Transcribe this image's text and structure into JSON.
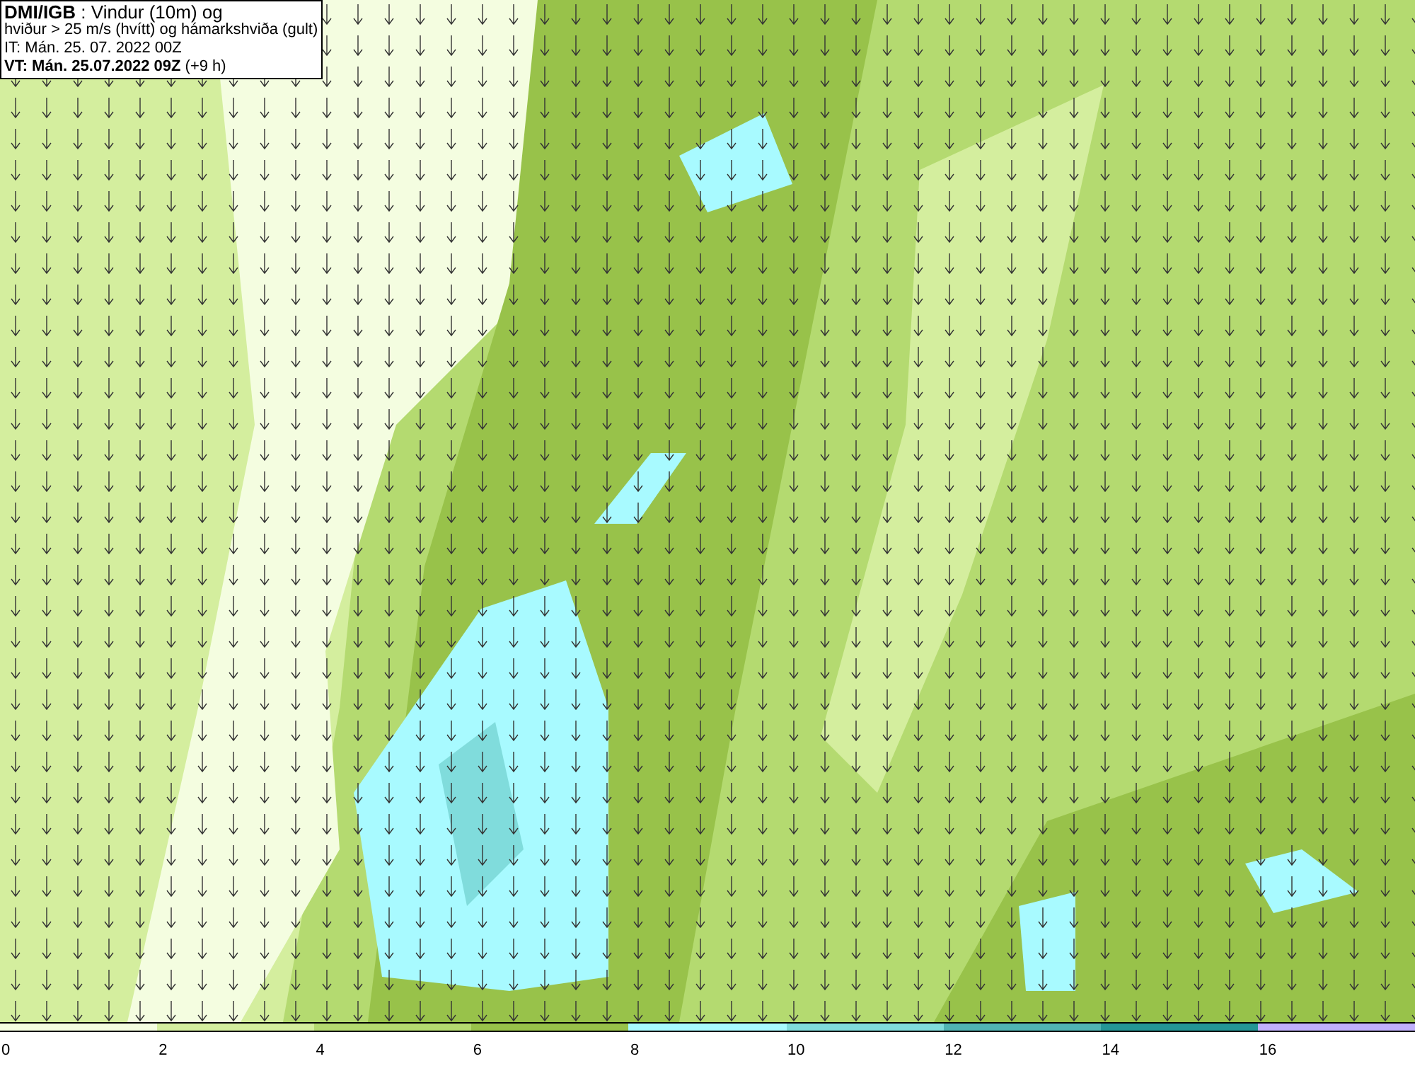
{
  "title": {
    "lines": [
      "**DMI/IGB** : Vindur (10m) og",
      "hviður > 25 m/s (hvítt) og hámarkshviða (gult)",
      "IT: Mán. 25. 07. 2022 00Z",
      "**VT: Mán. 25.07.2022 09Z** (+9 h)"
    ]
  },
  "legend": [
    {
      "label": "0",
      "color": "#f4fde0"
    },
    {
      "label": "2",
      "color": "#d4ee9e"
    },
    {
      "label": "4",
      "color": "#b4da70"
    },
    {
      "label": "6",
      "color": "#98c24a"
    },
    {
      "label": "8",
      "color": "#a8faff"
    },
    {
      "label": "10",
      "color": "#80dcdc"
    },
    {
      "label": "12",
      "color": "#50b4b4"
    },
    {
      "label": "14",
      "color": "#249696"
    },
    {
      "label": "16",
      "color": "#c0b0fc"
    }
  ]
}
